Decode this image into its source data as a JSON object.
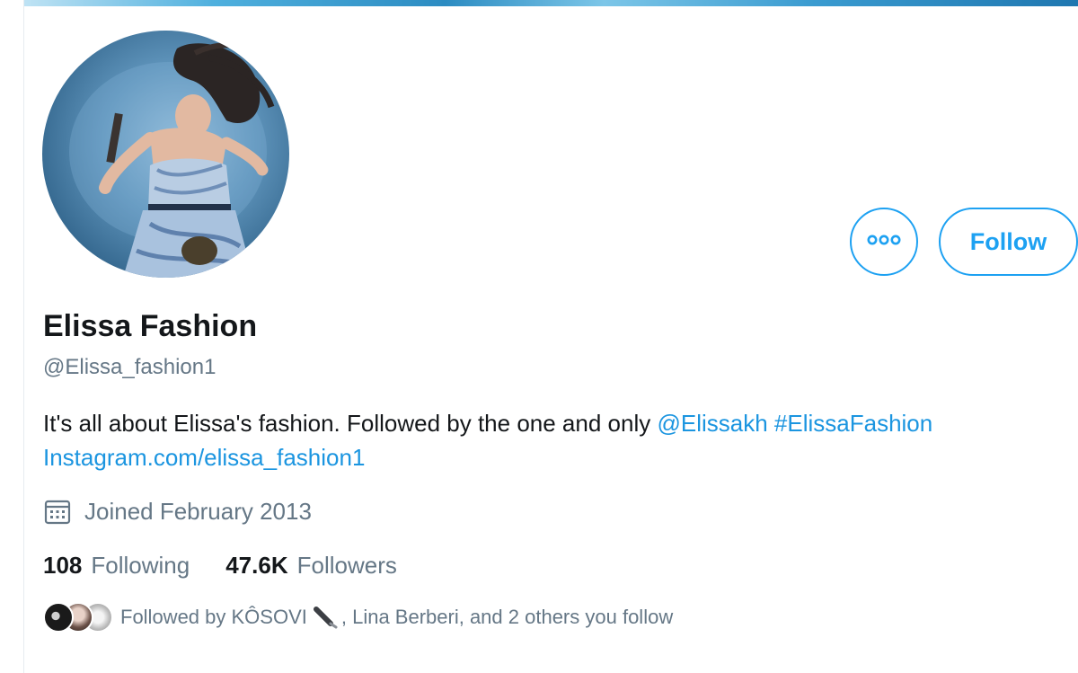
{
  "profile": {
    "display_name": "Elissa Fashion",
    "handle": "@Elissa_fashion1",
    "bio": {
      "text": "It's all about Elissa's fashion. Followed by the one and only",
      "mention": "@Elissakh",
      "hashtag": "#ElissaFashion",
      "link": "Instagram.com/elissa_fashion1"
    },
    "joined": "Joined February 2013",
    "joined_icon": "calendar-icon",
    "following_count": "108",
    "following_label": "Following",
    "followers_count": "47.6K",
    "followers_label": "Followers",
    "followed_by": {
      "prefix": "Followed by KÔSOVI",
      "suffix": ", Lina Berberi, and 2 others you follow",
      "emoji_icon": "microphone-icon"
    }
  },
  "actions": {
    "more_icon": "more-options-icon",
    "follow_label": "Follow"
  },
  "colors": {
    "accent": "#1da1f2",
    "link": "#1b95e0",
    "secondary_text": "#657786",
    "primary_text": "#14171a"
  }
}
